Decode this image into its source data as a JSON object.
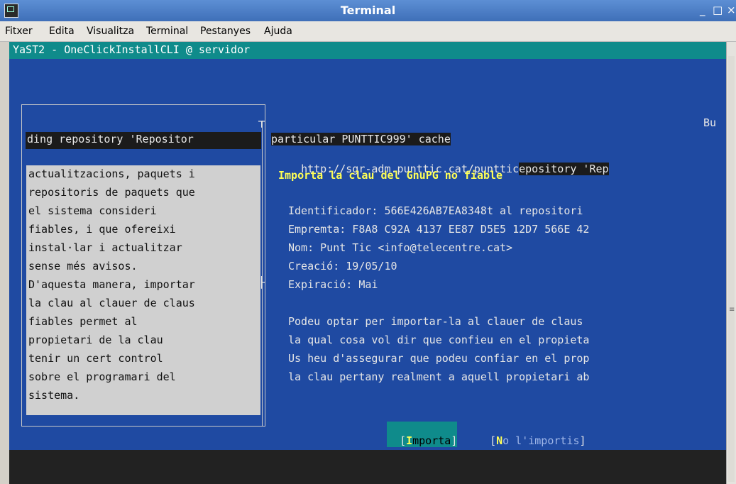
{
  "window": {
    "title": "Terminal",
    "minimize": "_",
    "maximize": "□",
    "close": "×"
  },
  "menu": [
    "Fitxer",
    "Edita",
    "Visualitza",
    "Terminal",
    "Pestanyes",
    "Ajuda"
  ],
  "terminal_title": "YaST2 - OneClickInstallCLI @ servidor",
  "top_right": "Bu",
  "repo_left": "ding repository 'Repositor",
  "repo_right": "particular PUNTTIC999' cache",
  "url_line": "http://sgr-adm.punttic.cat/punttic",
  "url_line_hl": "epository 'Rep",
  "dialog_title": "Importa la clau del GnuPG no fiable",
  "key_info": [
    "Identificador: 566E426AB7EA8348t al repositori",
    "Empremta: F8A8 C92A 4137 EE87 D5E5 12D7 566E 42",
    "Nom: Punt Tic <info@telecentre.cat>",
    "Creació: 19/05/10",
    "Expiració: Mai"
  ],
  "body_text": [
    "Podeu optar per importar-la al clauer de claus",
    "la qual cosa vol dir que confieu en el propieta",
    "Us heu d'assegurar que podeu confiar en el prop",
    "la clau pertany realment a aquell propietari ab"
  ],
  "help_text": [
    "actualitzacions, paquets i",
    "repositoris de paquets que",
    "el sistema consideri",
    "fiables, i que ofereixi",
    "instal·lar i actualitzar",
    "sense més avisos.",
    "D'aquesta manera, importar",
    "la clau al clauer de claus",
    "fiables permet al",
    "propietari de la clau",
    "tenir un cert control",
    "sobre el programari del",
    "sistema."
  ],
  "buttons": {
    "import": {
      "open": "[",
      "hotkey": "I",
      "rest": "mporta",
      "close": "]"
    },
    "dont_import": {
      "open": "[",
      "hotkey": "N",
      "rest": "o l'importis",
      "close": "]"
    }
  },
  "colors": {
    "terminal_bg": "#1f4aa2",
    "accent": "#0f8b8b",
    "highlight": "#ffff55"
  }
}
